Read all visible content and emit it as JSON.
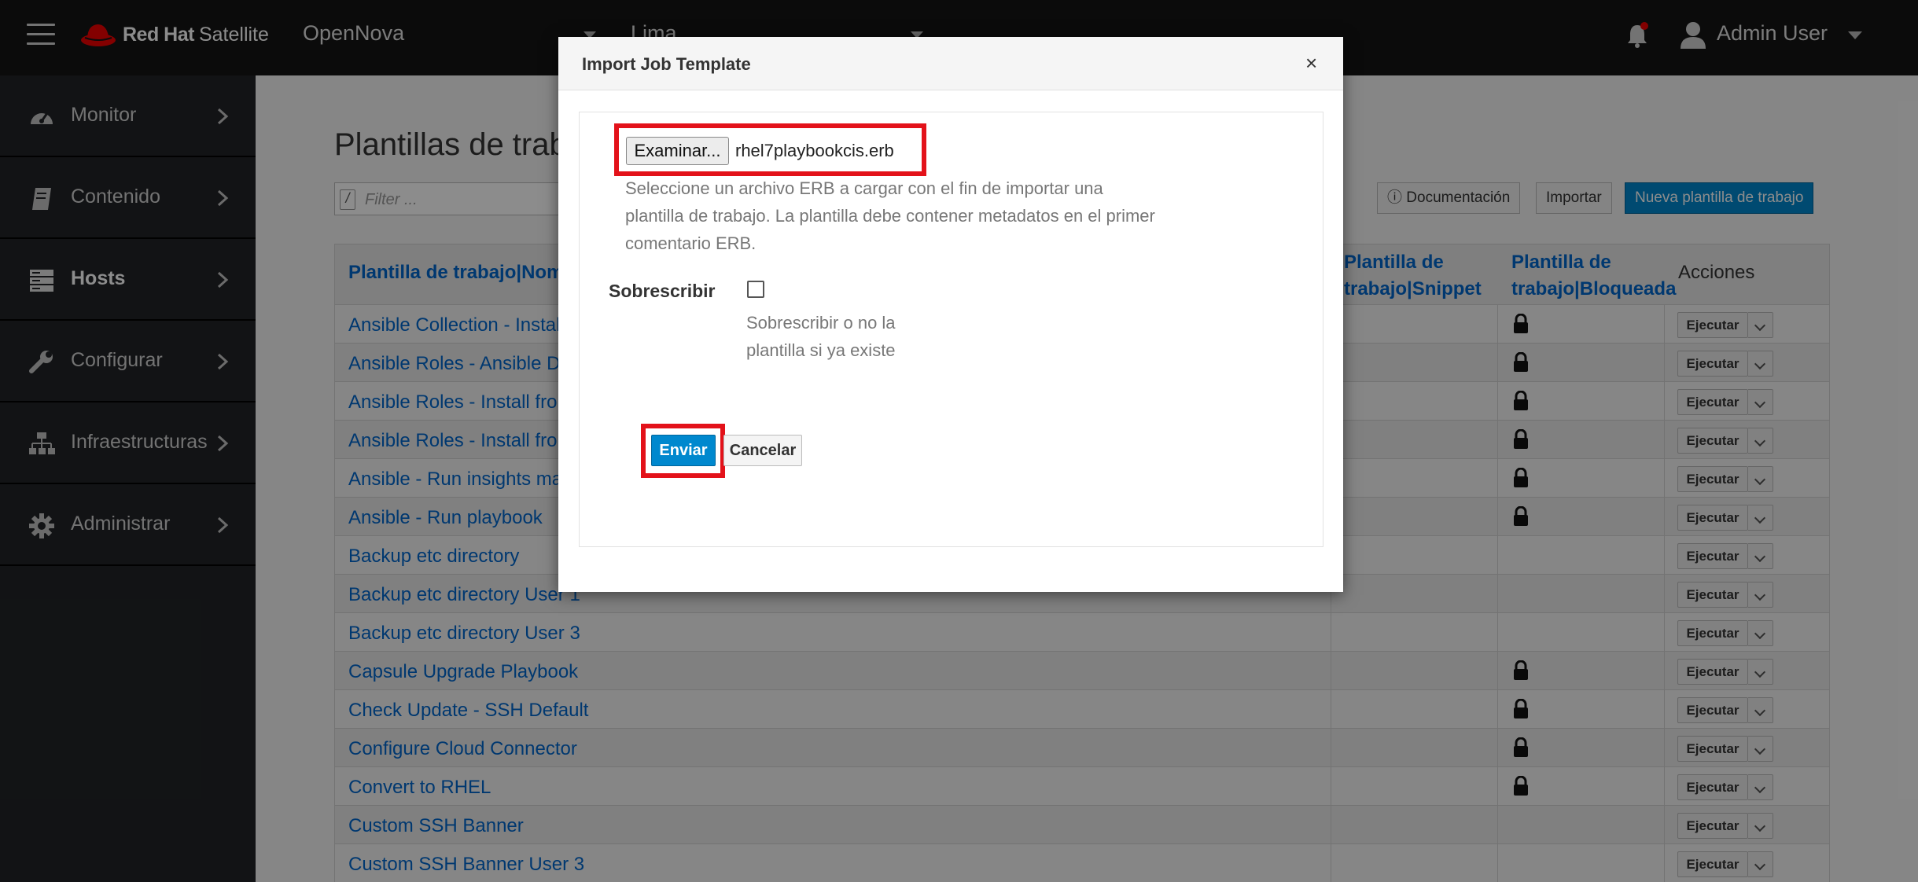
{
  "topbar": {
    "brand_bold": "Red Hat",
    "brand_product": "Satellite",
    "organization": "OpenNova",
    "location": "Lima",
    "user": "Admin User"
  },
  "sidebar": {
    "items": [
      {
        "label": "Monitor",
        "icon": "dashboard-icon"
      },
      {
        "label": "Contenido",
        "icon": "book-icon"
      },
      {
        "label": "Hosts",
        "icon": "server-icon"
      },
      {
        "label": "Configurar",
        "icon": "wrench-icon"
      },
      {
        "label": "Infraestructuras",
        "icon": "network-icon"
      },
      {
        "label": "Administrar",
        "icon": "gear-icon"
      }
    ],
    "active": "Hosts"
  },
  "main": {
    "title": "Plantillas de trabajo",
    "filter_placeholder": "Filter ...",
    "buttons": {
      "documentation": "Documentación",
      "import": "Importar",
      "new": "Nueva plantilla de trabajo"
    },
    "table": {
      "headers": {
        "name": "Plantilla de trabajo|Nombre",
        "snippet_line1": "Plantilla de",
        "snippet_line2": "trabajo|Snippet",
        "locked_line1": "Plantilla de",
        "locked_line2": "trabajo|Bloqueada",
        "actions": "Acciones"
      },
      "run_label": "Ejecutar",
      "rows": [
        {
          "name": "Ansible Collection - Install from Galaxy",
          "locked": true
        },
        {
          "name": "Ansible Roles - Ansible Default",
          "locked": true
        },
        {
          "name": "Ansible Roles - Install from git",
          "locked": true
        },
        {
          "name": "Ansible Roles - Install from Galaxy",
          "locked": true
        },
        {
          "name": "Ansible - Run insights maintenance plan",
          "locked": true
        },
        {
          "name": "Ansible - Run playbook",
          "locked": true
        },
        {
          "name": "Backup etc directory",
          "locked": false
        },
        {
          "name": "Backup etc directory User 1",
          "locked": false
        },
        {
          "name": "Backup etc directory User 3",
          "locked": false
        },
        {
          "name": "Capsule Upgrade Playbook",
          "locked": true
        },
        {
          "name": "Check Update - SSH Default",
          "locked": true
        },
        {
          "name": "Configure Cloud Connector",
          "locked": true
        },
        {
          "name": "Convert to RHEL",
          "locked": true
        },
        {
          "name": "Custom SSH Banner",
          "locked": false
        },
        {
          "name": "Custom SSH Banner User 3",
          "locked": false
        }
      ]
    }
  },
  "modal": {
    "title": "Import Job Template",
    "close": "×",
    "file_button": "Examinar...",
    "file_name": "rhel7playbookcis.erb",
    "file_help": "Seleccione un archivo ERB a cargar con el fin de importar una plantilla de trabajo. La plantilla debe contener metadatos en el primer comentario ERB.",
    "overwrite_label": "Sobrescribir",
    "overwrite_checked": false,
    "overwrite_help": "Sobrescribir o no la plantilla si ya existe",
    "submit": "Enviar",
    "cancel": "Cancelar"
  },
  "colors": {
    "accent": "#0088ce",
    "highlight": "#e3121a",
    "link": "#0066cc"
  }
}
